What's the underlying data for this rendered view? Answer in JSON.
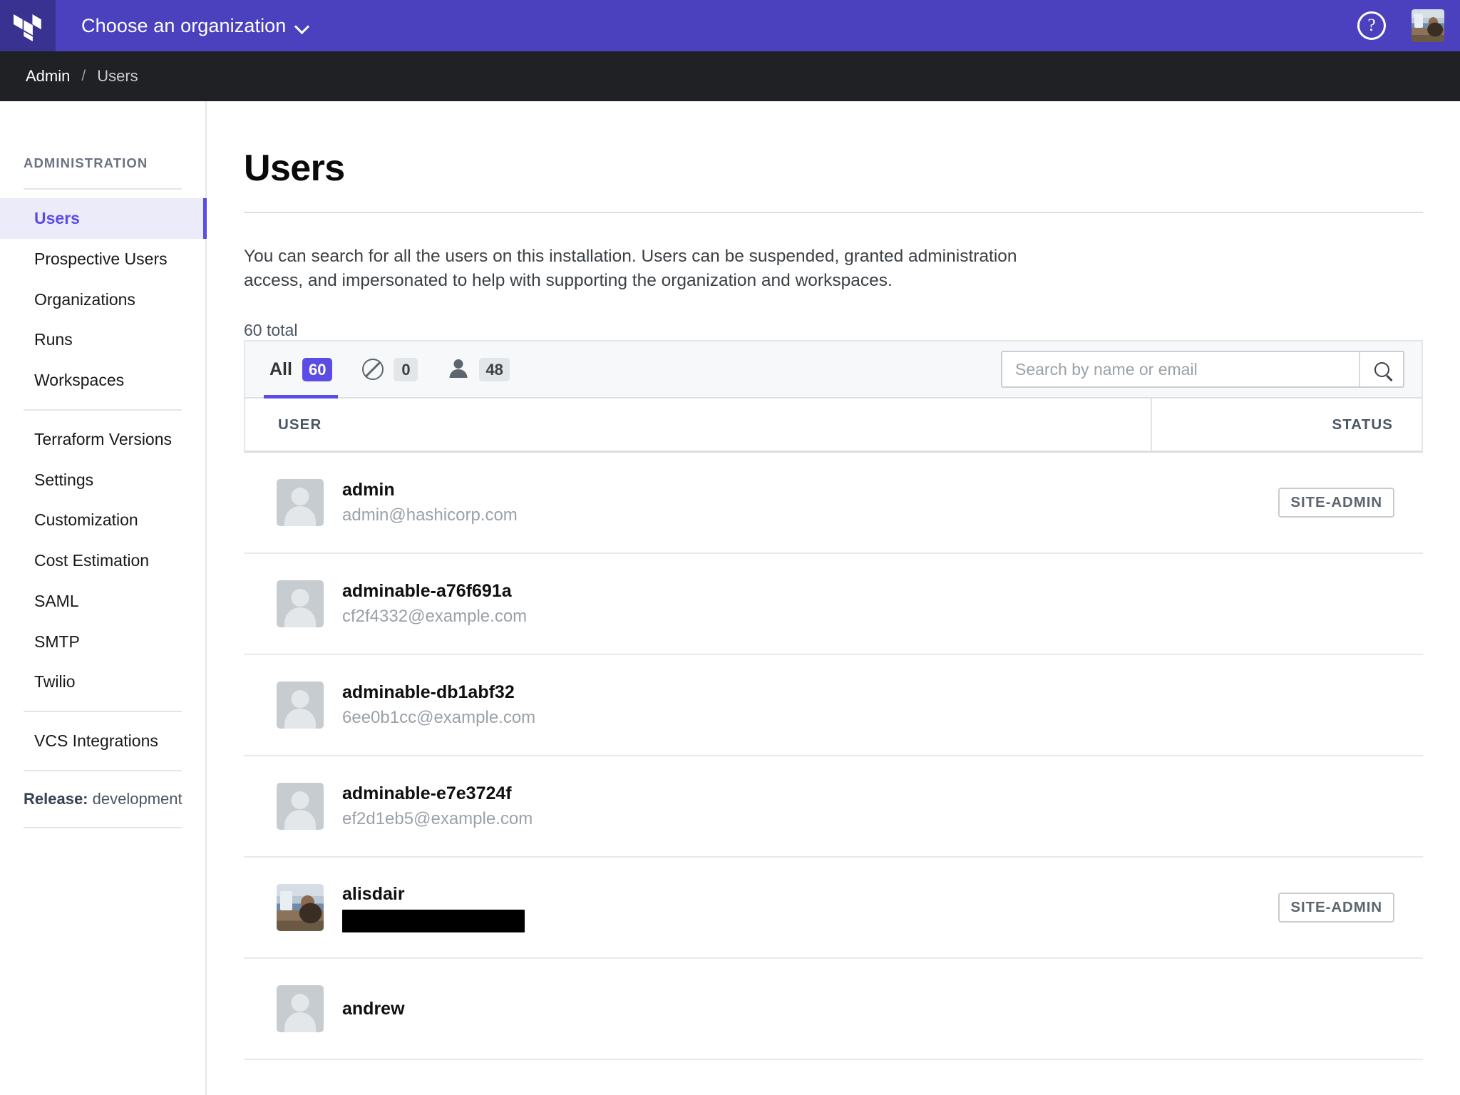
{
  "topbar": {
    "logo_icon": "terraform-logo-icon",
    "org_chooser_label": "Choose an organization",
    "chevron_icon": "chevron-down-icon",
    "help_icon": "help-question-icon",
    "help_glyph": "?",
    "avatar_icon": "user-avatar",
    "bg_color": "#4B41BE",
    "logo_bg_color": "#3A3291"
  },
  "breadcrumb": {
    "root": "Admin",
    "separator": "/",
    "current": "Users"
  },
  "sidebar": {
    "heading": "ADMINISTRATION",
    "group_one": [
      {
        "label": "Users",
        "active": true
      },
      {
        "label": "Prospective Users",
        "active": false
      },
      {
        "label": "Organizations",
        "active": false
      },
      {
        "label": "Runs",
        "active": false
      },
      {
        "label": "Workspaces",
        "active": false
      }
    ],
    "group_two": [
      {
        "label": "Terraform Versions"
      },
      {
        "label": "Settings"
      },
      {
        "label": "Customization"
      },
      {
        "label": "Cost Estimation"
      },
      {
        "label": "SAML"
      },
      {
        "label": "SMTP"
      },
      {
        "label": "Twilio"
      }
    ],
    "group_three": [
      {
        "label": "VCS Integrations"
      }
    ],
    "release_label": "Release:",
    "release_value": "development",
    "active_color": "#5B4CE6",
    "active_bg": "#ECEBFA"
  },
  "main": {
    "title": "Users",
    "description": "You can search for all the users on this installation. Users can be suspended, granted administration access, and impersonated to help with supporting the organization and workspaces.",
    "total": "60 total"
  },
  "filters": {
    "tabs": [
      {
        "label": "All",
        "icon": null,
        "count": "60",
        "active": true,
        "badge_style": "purple"
      },
      {
        "label": null,
        "icon": "ban-circle-icon",
        "count": "0",
        "active": false,
        "badge_style": "grey"
      },
      {
        "label": null,
        "icon": "person-icon",
        "count": "48",
        "active": false,
        "badge_style": "grey"
      }
    ],
    "search": {
      "placeholder": "Search by name or email",
      "value": "",
      "button_icon": "search-icon"
    }
  },
  "table": {
    "columns": {
      "user": "USER",
      "status": "STATUS"
    },
    "rows": [
      {
        "name": "admin",
        "email": "admin@hashicorp.com",
        "email_redacted": false,
        "avatar_type": "placeholder",
        "status": "SITE-ADMIN"
      },
      {
        "name": "adminable-a76f691a",
        "email": "cf2f4332@example.com",
        "email_redacted": false,
        "avatar_type": "placeholder",
        "status": ""
      },
      {
        "name": "adminable-db1abf32",
        "email": "6ee0b1cc@example.com",
        "email_redacted": false,
        "avatar_type": "placeholder",
        "status": ""
      },
      {
        "name": "adminable-e7e3724f",
        "email": "ef2d1eb5@example.com",
        "email_redacted": false,
        "avatar_type": "placeholder",
        "status": ""
      },
      {
        "name": "alisdair",
        "email": "",
        "email_redacted": true,
        "avatar_type": "photo",
        "status": "SITE-ADMIN"
      },
      {
        "name": "andrew",
        "email": "",
        "email_redacted": false,
        "avatar_type": "placeholder",
        "status": ""
      }
    ]
  }
}
